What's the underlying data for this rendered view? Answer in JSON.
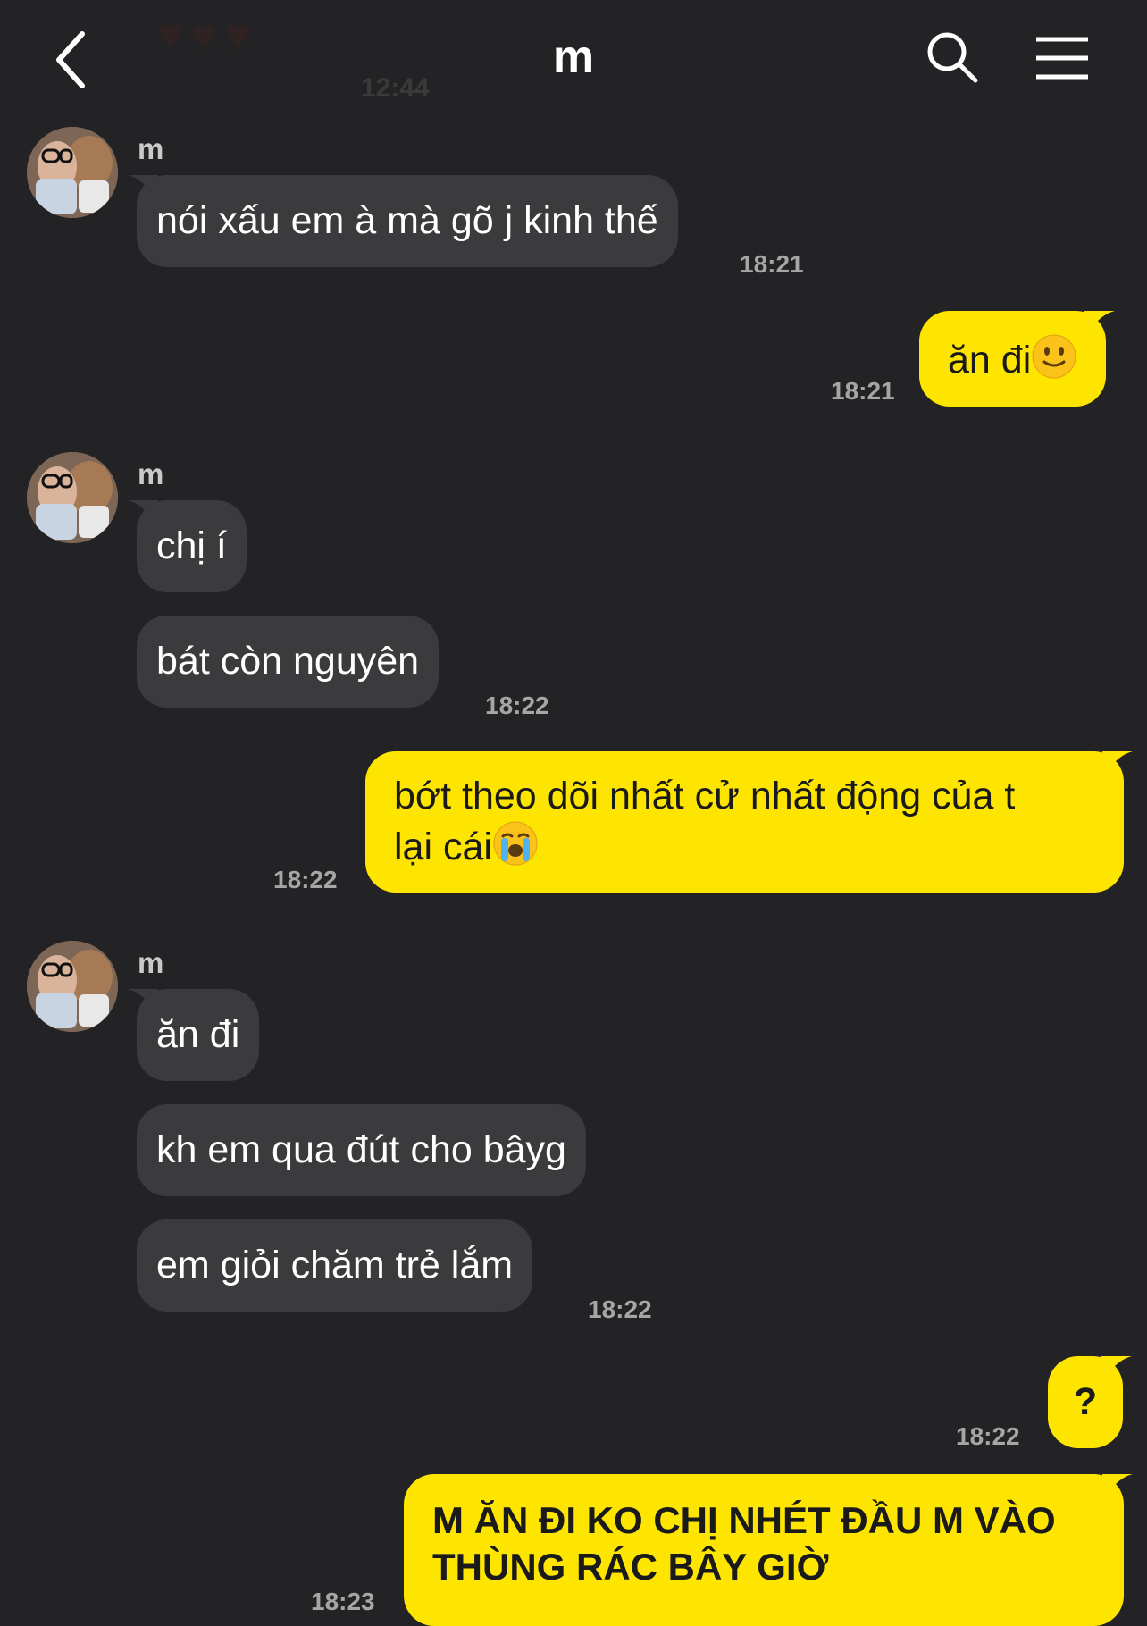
{
  "header": {
    "title": "m",
    "faded_time": "12:44",
    "faded_hearts": "♥♥♥"
  },
  "messages": [
    {
      "dir": "in",
      "sender": "m",
      "text": "nói xấu em à mà gõ j kinh thế",
      "time": "18:21"
    },
    {
      "dir": "out",
      "text": "ăn đi",
      "emoji": "slightly-smiling-face",
      "time": "18:21"
    },
    {
      "dir": "in",
      "sender": "m",
      "text": "chị í"
    },
    {
      "dir": "in",
      "text": "bát còn nguyên",
      "time": "18:22"
    },
    {
      "dir": "out",
      "line1": "bớt theo dõi nhất cử nhất động của t",
      "line2": "lại cái",
      "emoji": "loudly-crying-face",
      "time": "18:22"
    },
    {
      "dir": "in",
      "sender": "m",
      "text": "ăn đi"
    },
    {
      "dir": "in",
      "text": "kh em qua đút cho bâyg"
    },
    {
      "dir": "in",
      "text": "em giỏi chăm trẻ lắm",
      "time": "18:22"
    },
    {
      "dir": "out",
      "text": "?",
      "time": "18:22"
    },
    {
      "dir": "out",
      "line1": "M ĂN ĐI KO CHỊ NHÉT ĐẦU M VÀO",
      "line2": "THÙNG RÁC BÂY GIỜ",
      "time": "18:23"
    }
  ],
  "colors": {
    "background": "#232325",
    "incoming_bubble": "#3b3b3d",
    "outgoing_bubble": "#fee500",
    "timestamp": "#a6a6a6"
  }
}
